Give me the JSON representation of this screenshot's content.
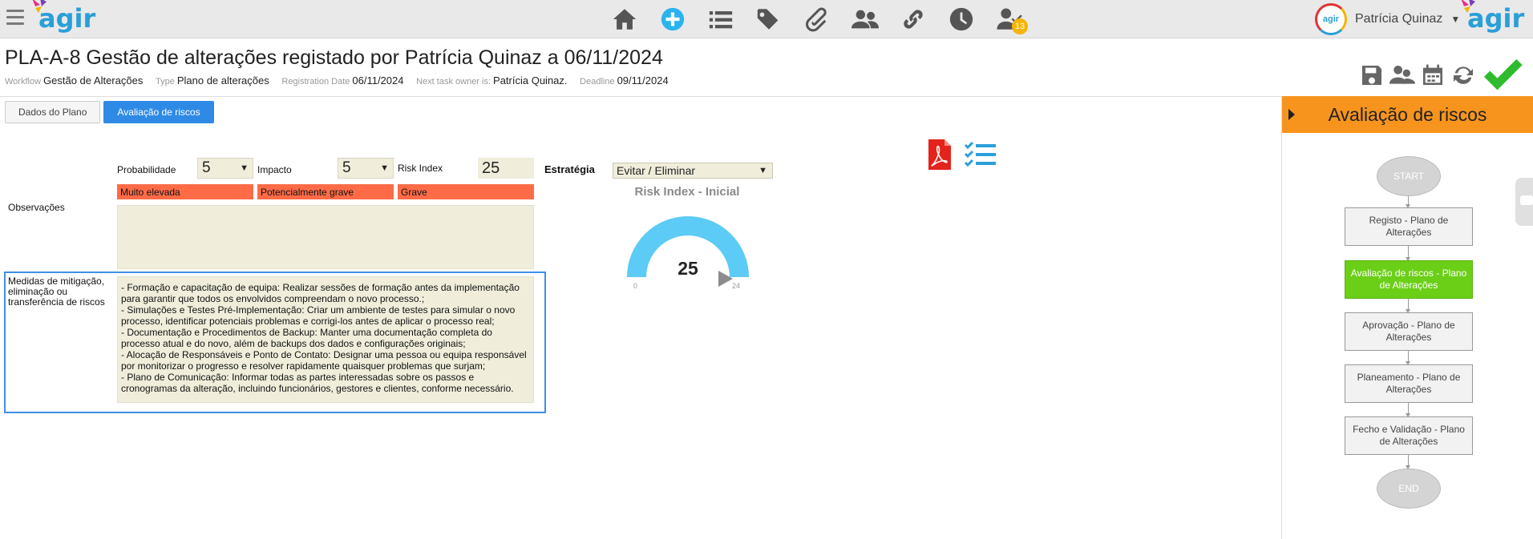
{
  "header": {
    "logo_text": "agir",
    "nav_icons": [
      "home-icon",
      "add-icon",
      "list-icon",
      "tags-icon",
      "attachment-icon",
      "users-icon",
      "link-icon",
      "clock-icon",
      "user-check-icon"
    ],
    "notification_count": "13",
    "user_name": "Patrícia Quinaz",
    "avatar_text": "agir"
  },
  "page": {
    "title": "PLA-A-8 Gestão de alterações registado por Patrícia Quinaz a 06/11/2024",
    "meta": {
      "workflow_label": "Workflow",
      "workflow_value": "Gestão de Alterações",
      "type_label": "Type",
      "type_value": "Plano de alterações",
      "regdate_label": "Registration Date",
      "regdate_value": "06/11/2024",
      "owner_label": "Next task owner is:",
      "owner_value": "Patrícia Quinaz.",
      "deadline_label": "Deadline",
      "deadline_value": "09/11/2024"
    }
  },
  "tabs": [
    {
      "label": "Dados do Plano",
      "active": false
    },
    {
      "label": "Avaliação de riscos",
      "active": true
    }
  ],
  "form": {
    "probabilidade_label": "Probabilidade",
    "probabilidade_value": "5",
    "impacto_label": "Impacto",
    "impacto_value": "5",
    "risk_index_label": "Risk Index",
    "risk_index_value": "25",
    "estrategia_label": "Estratégia",
    "estrategia_value": "Evitar / Eliminar",
    "prob_text": "Muito elevada",
    "impact_text": "Potencialmente grave",
    "risk_text": "Grave",
    "observacoes_label": "Observações",
    "observacoes_value": "",
    "medidas_label": "Medidas de mitigação, eliminação ou transferência de riscos",
    "medidas_value": "- Formação e capacitação de equipa: Realizar sessões de formação antes da implementação para garantir que todos os envolvidos compreendam o novo processo.;\n- Simulações e Testes Pré-Implementação: Criar um ambiente de testes para simular o novo processo, identificar potenciais problemas e corrigi-los antes de aplicar o processo real;\n- Documentação e Procedimentos de Backup: Manter uma documentação completa do processo atual e do novo, além de backups dos dados e configurações originais;\n- Alocação de Responsáveis e Ponto de Contato: Designar uma pessoa ou equipa responsável por monitorizar o progresso e resolver rapidamente quaisquer problemas que surjam;\n- Plano de Comunicação: Informar todas as partes interessadas sobre os passos e cronogramas da alteração, incluindo funcionários, gestores e clientes, conforme necessário."
  },
  "gauge": {
    "title": "Risk Index - Inicial",
    "value": "25",
    "min": "0",
    "max": "24",
    "fill_fraction": 1.0,
    "color": "#5ccbf5"
  },
  "workflow_panel": {
    "title": "Avaliação de riscos",
    "start_label": "START",
    "end_label": "END",
    "steps": [
      {
        "label": "Registo - Plano de Alterações",
        "current": false
      },
      {
        "label": "Avaliação de riscos - Plano de Alterações",
        "current": true
      },
      {
        "label": "Aprovação - Plano de Alterações",
        "current": false
      },
      {
        "label": "Planeamento - Plano de Alterações",
        "current": false
      },
      {
        "label": "Fecho e Validação - Plano de Alterações",
        "current": false
      }
    ]
  },
  "colors": {
    "accent": "#2f8ae5",
    "panel_header": "#f7941d",
    "current_step": "#6bcf17",
    "risk_bar": "#ff6b47",
    "field_bg": "#f0eedb",
    "confirm": "#2ebc2e"
  }
}
